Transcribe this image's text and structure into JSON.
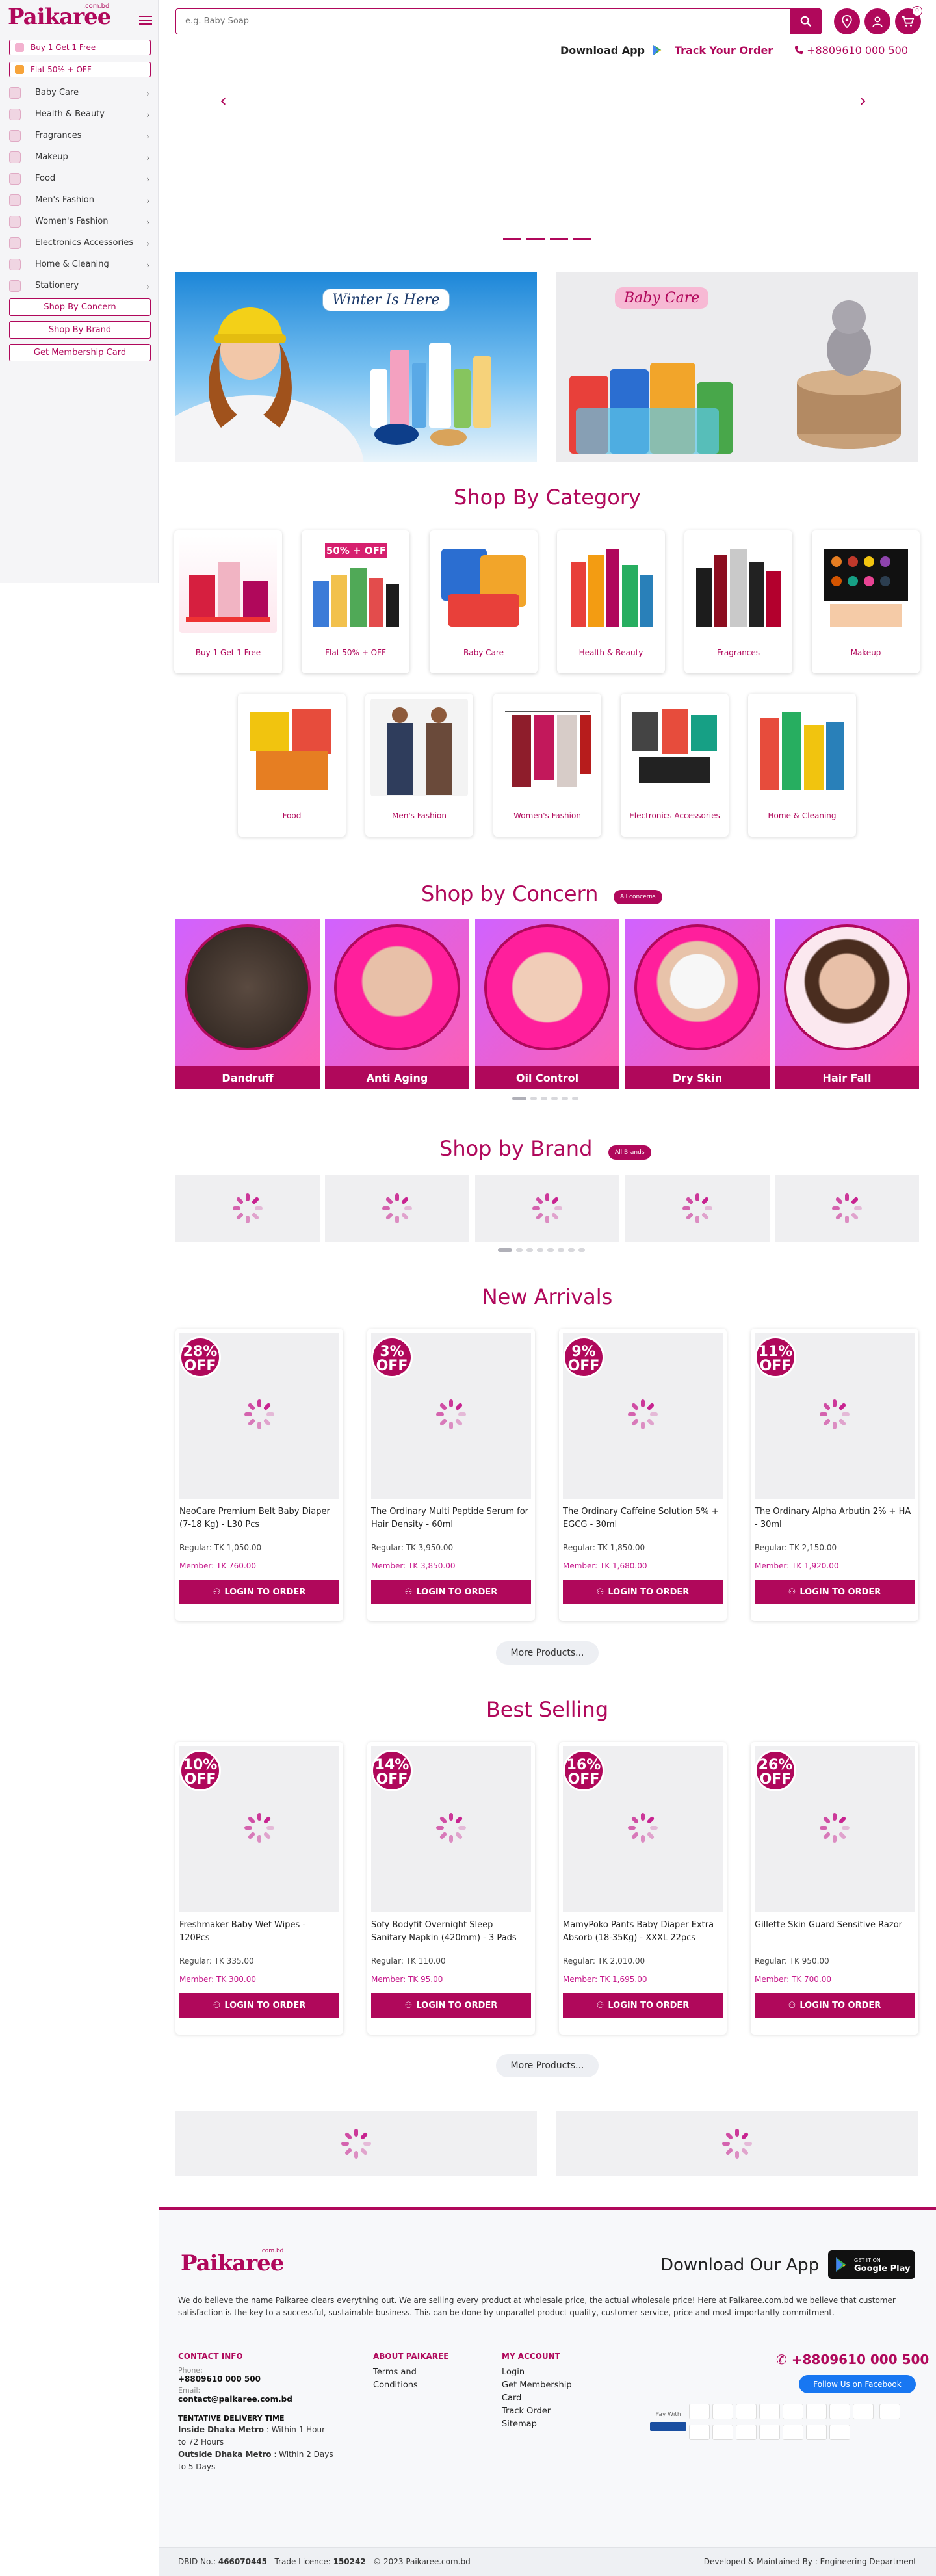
{
  "brand": {
    "name": "Paikaree",
    "domain_tag": ".com.bd",
    "color": "#b0085b"
  },
  "sidebar": {
    "promos": [
      {
        "label": "Buy 1 Get 1 Free"
      },
      {
        "label": "Flat 50% + OFF"
      }
    ],
    "items": [
      {
        "label": "Baby Care"
      },
      {
        "label": "Health & Beauty"
      },
      {
        "label": "Fragrances"
      },
      {
        "label": "Makeup"
      },
      {
        "label": "Food"
      },
      {
        "label": "Men's Fashion"
      },
      {
        "label": "Women's Fashion"
      },
      {
        "label": "Electronics Accessories"
      },
      {
        "label": "Home & Cleaning"
      },
      {
        "label": "Stationery"
      }
    ],
    "buttons": [
      {
        "label": "Shop By Concern"
      },
      {
        "label": "Shop By Brand"
      },
      {
        "label": "Get Membership Card"
      }
    ]
  },
  "header": {
    "search_placeholder": "e.g. Baby Soap",
    "cart_count": "0",
    "download_app": "Download App",
    "track_order": "Track Your Order",
    "phone": "+8809610 000 500"
  },
  "banners": {
    "winter": "Winter Is Here",
    "baby": "Baby Care"
  },
  "shop_by_category": {
    "title": "Shop By Category",
    "items": [
      {
        "label": "Buy 1 Get 1 Free"
      },
      {
        "label": "Flat 50% + OFF"
      },
      {
        "label": "Baby Care"
      },
      {
        "label": "Health & Beauty"
      },
      {
        "label": "Fragrances"
      },
      {
        "label": "Makeup"
      },
      {
        "label": "Food"
      },
      {
        "label": "Men's Fashion"
      },
      {
        "label": "Women's Fashion"
      },
      {
        "label": "Electronics Accessories"
      },
      {
        "label": "Home & Cleaning"
      }
    ],
    "flat_badge": "50% + OFF"
  },
  "shop_by_concern": {
    "title": "Shop by Concern",
    "all_label": "All concerns",
    "items": [
      {
        "label": "Dandruff"
      },
      {
        "label": "Anti Aging"
      },
      {
        "label": "Oil Control"
      },
      {
        "label": "Dry Skin"
      },
      {
        "label": "Hair Fall"
      }
    ]
  },
  "shop_by_brand": {
    "title": "Shop by Brand",
    "all_label": "All Brands"
  },
  "new_arrivals": {
    "title": "New Arrivals",
    "more": "More Products...",
    "products": [
      {
        "off": "28%",
        "off_word": "OFF",
        "name": "NeoCare Premium Belt Baby Diaper (7-18 Kg) - L30 Pcs",
        "regular": "Regular: TK 1,050.00",
        "member": "Member: TK 760.00",
        "btn": "LOGIN TO ORDER"
      },
      {
        "off": "3%",
        "off_word": "OFF",
        "name": "The Ordinary Multi Peptide Serum for Hair Density - 60ml",
        "regular": "Regular: TK 3,950.00",
        "member": "Member: TK 3,850.00",
        "btn": "LOGIN TO ORDER"
      },
      {
        "off": "9%",
        "off_word": "OFF",
        "name": "The Ordinary Caffeine Solution 5% + EGCG - 30ml",
        "regular": "Regular: TK 1,850.00",
        "member": "Member: TK 1,680.00",
        "btn": "LOGIN TO ORDER"
      },
      {
        "off": "11%",
        "off_word": "OFF",
        "name": "The Ordinary Alpha Arbutin 2% + HA - 30ml",
        "regular": "Regular: TK 2,150.00",
        "member": "Member: TK 1,920.00",
        "btn": "LOGIN TO ORDER"
      }
    ]
  },
  "best_selling": {
    "title": "Best Selling",
    "more": "More Products...",
    "products": [
      {
        "off": "10%",
        "off_word": "OFF",
        "name": "Freshmaker Baby Wet Wipes - 120Pcs",
        "regular": "Regular: TK 335.00",
        "member": "Member: TK 300.00",
        "btn": "LOGIN TO ORDER"
      },
      {
        "off": "14%",
        "off_word": "OFF",
        "name": "Sofy Bodyfit Overnight Sleep Sanitary Napkin (420mm) - 3 Pads",
        "regular": "Regular: TK 110.00",
        "member": "Member: TK 95.00",
        "btn": "LOGIN TO ORDER"
      },
      {
        "off": "16%",
        "off_word": "OFF",
        "name": "MamyPoko Pants Baby Diaper Extra Absorb (18-35Kg) - XXXL 22pcs",
        "regular": "Regular: TK 2,010.00",
        "member": "Member: TK 1,695.00",
        "btn": "LOGIN TO ORDER"
      },
      {
        "off": "26%",
        "off_word": "OFF",
        "name": "Gillette Skin Guard Sensitive Razor",
        "regular": "Regular: TK 950.00",
        "member": "Member: TK 700.00",
        "btn": "LOGIN TO ORDER"
      }
    ]
  },
  "footer": {
    "download_app": "Download Our App",
    "google_play_small": "GET IT ON",
    "google_play_big": "Google Play",
    "about_text": "We do believe the name Paikaree clears everything out. We are selling every product at wholesale price, the actual wholesale price! Here at Paikaree.com.bd we believe that customer satisfaction is the key to a successful, sustainable business. This can be done by unparallel product quality, customer service, price and most importantly commitment.",
    "contact_head": "CONTACT INFO",
    "phone_label": "Phone:",
    "phone": "+8809610 000 500",
    "email_label": "Email:",
    "email": "contact@paikaree.com.bd",
    "delivery_head": "TENTATIVE DELIVERY TIME",
    "inside_label": "Inside Dhaka Metro",
    "inside_value": ": Within 1 Hour to 72 Hours",
    "outside_label": "Outside Dhaka Metro",
    "outside_value": ": Within 2 Days to 5 Days",
    "about_head": "ABOUT PAIKAREE",
    "about_links": [
      "Terms and Conditions"
    ],
    "account_head": "MY ACCOUNT",
    "account_links": [
      "Login",
      "Get Membership Card",
      "Track Order",
      "Sitemap"
    ],
    "right_phone": "+8809610 000 500",
    "facebook": "Follow Us on Facebook",
    "pay_with": "Pay With",
    "dbid_label": "DBID No.:",
    "dbid": "466070445",
    "trade_label": "Trade Licence:",
    "trade": "150242",
    "copyright": "© 2023 Paikaree.com.bd",
    "developed": "Developed & Maintained By : Engineering Department"
  }
}
